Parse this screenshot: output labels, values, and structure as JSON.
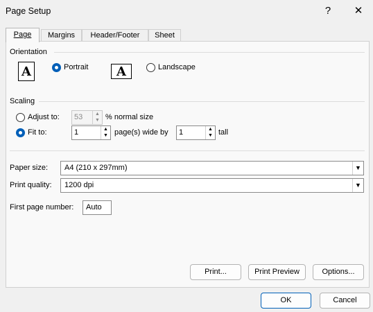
{
  "window": {
    "title": "Page Setup",
    "help_label": "?",
    "close_label": "✕"
  },
  "tabs": [
    {
      "label": "Page"
    },
    {
      "label": "Margins"
    },
    {
      "label": "Header/Footer"
    },
    {
      "label": "Sheet"
    }
  ],
  "orientation": {
    "section_label": "Orientation",
    "icon_glyph": "A",
    "portrait_label": "Portrait",
    "landscape_label": "Landscape",
    "selected": "portrait"
  },
  "scaling": {
    "section_label": "Scaling",
    "adjust_to_label": "Adjust to:",
    "adjust_value": "53",
    "adjust_suffix": "% normal size",
    "fit_to_label": "Fit to:",
    "fit_wide_value": "1",
    "fit_wide_suffix": "page(s) wide by",
    "fit_tall_value": "1",
    "fit_tall_suffix": "tall",
    "selected": "fit_to"
  },
  "paper": {
    "paper_size_label": "Paper size:",
    "paper_size_value": "A4 (210 x 297mm)",
    "print_quality_label": "Print quality:",
    "print_quality_value": "1200 dpi",
    "first_page_label": "First page number:",
    "first_page_value": "Auto"
  },
  "buttons": {
    "print": "Print...",
    "print_preview": "Print Preview",
    "options": "Options...",
    "ok": "OK",
    "cancel": "Cancel"
  },
  "colors": {
    "accent": "#005fb8",
    "background": "#f0f0f0",
    "panel": "#f9f9f9"
  }
}
